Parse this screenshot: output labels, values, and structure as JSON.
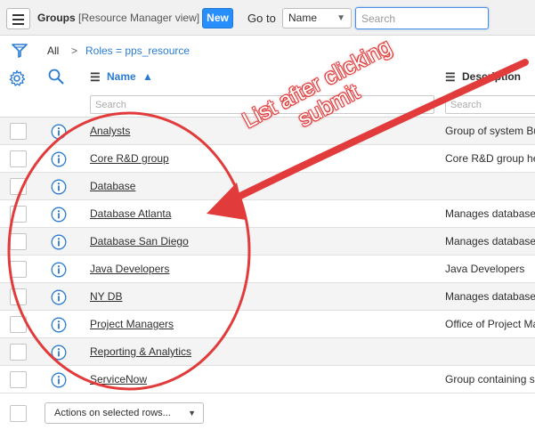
{
  "header": {
    "title": "Groups",
    "view_label": "[Resource Manager view]",
    "new_label": "New",
    "goto_label": "Go to",
    "goto_field": "Name",
    "search_placeholder": "Search"
  },
  "breadcrumbs": {
    "all": "All",
    "separator": ">",
    "filter": "Roles = pps_resource"
  },
  "columns": {
    "name": "Name",
    "name_sort_icon": "sort-ascending-icon",
    "description": "Description",
    "name_search_placeholder": "Search",
    "description_search_placeholder": "Search"
  },
  "rows": [
    {
      "name": "Analysts",
      "description": "Group of system Bu"
    },
    {
      "name": "Core R&D group",
      "description": "Core R&D group he"
    },
    {
      "name": "Database",
      "description": ""
    },
    {
      "name": "Database Atlanta",
      "description": "Manages database"
    },
    {
      "name": "Database San Diego",
      "description": "Manages database"
    },
    {
      "name": "Java Developers",
      "description": "Java Developers"
    },
    {
      "name": "NY DB",
      "description": "Manages database"
    },
    {
      "name": "Project Managers",
      "description": "Office of Project Ma"
    },
    {
      "name": "Reporting & Analytics",
      "description": ""
    },
    {
      "name": "ServiceNow",
      "description": "Group containing s"
    }
  ],
  "footer": {
    "actions_label": "Actions on selected rows..."
  },
  "annotation": {
    "line1": "List after clicking",
    "line2": "submit",
    "color": "#e23b3b"
  },
  "colors": {
    "accent": "#278efc",
    "link": "#2a7cd2",
    "annotation_red": "#e23b3b"
  }
}
